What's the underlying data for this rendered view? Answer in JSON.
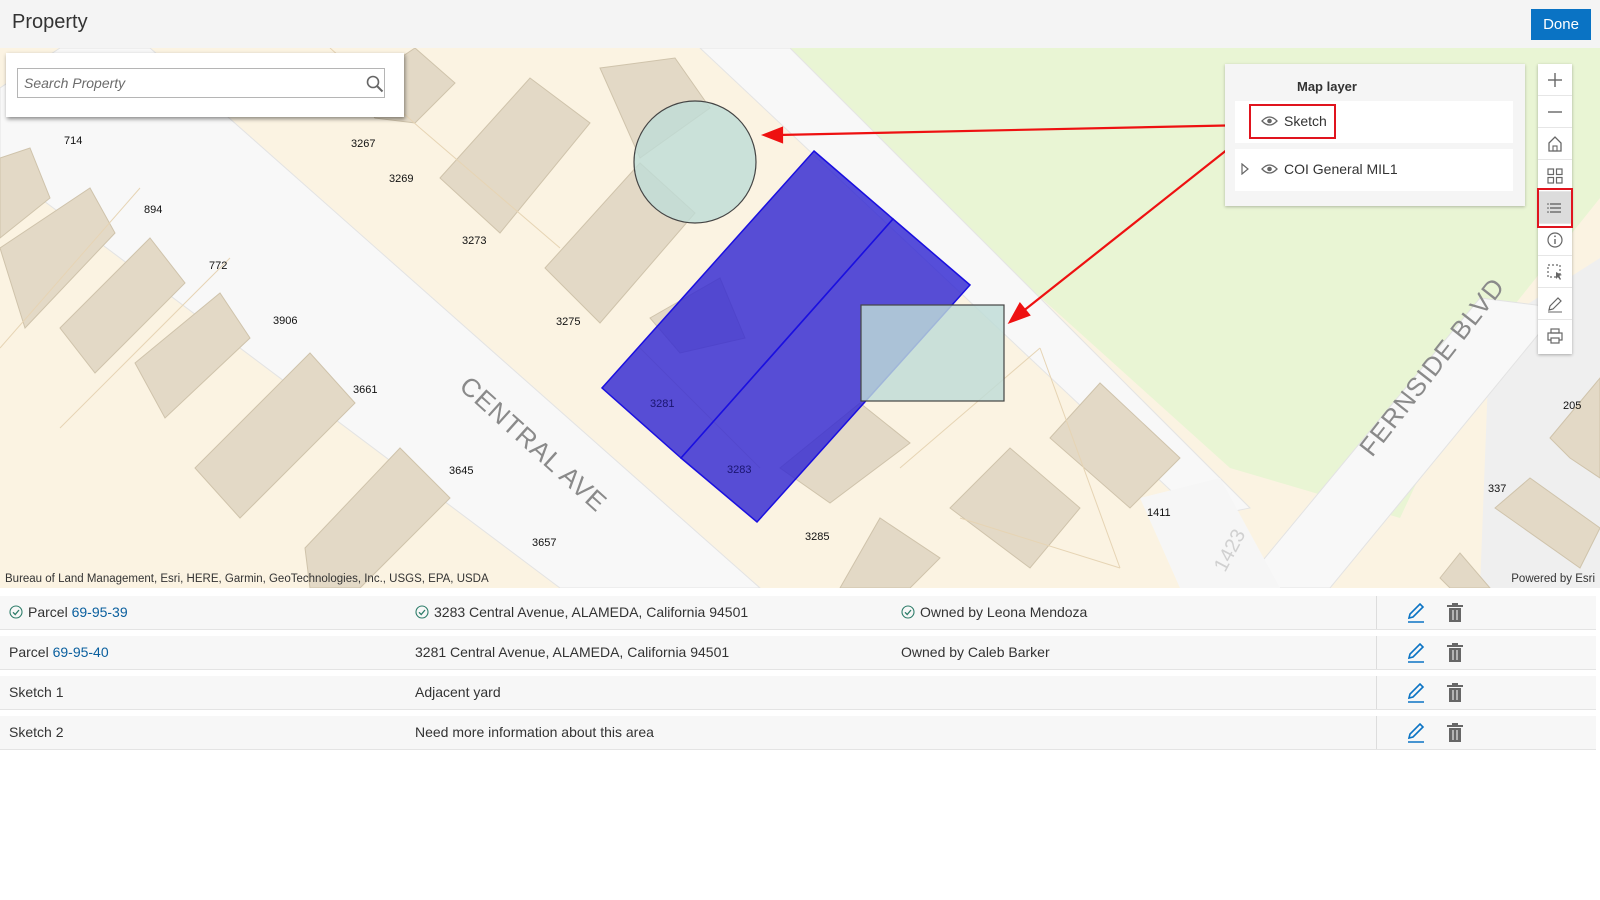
{
  "header": {
    "title": "Property",
    "done_label": "Done"
  },
  "search": {
    "placeholder": "Search Property"
  },
  "map": {
    "street_labels": [
      "CENTRAL AVE",
      "FERNSIDE BLVD"
    ],
    "parcel_labels": [
      "714",
      "3267",
      "3269",
      "894",
      "3273",
      "772",
      "3906",
      "3275",
      "3661",
      "3645",
      "3657",
      "3285",
      "1411",
      "205",
      "337",
      "3281",
      "3283",
      "1423"
    ],
    "attribution": "Bureau of Land Management, Esri, HERE, Garmin, GeoTechnologies, Inc., USGS, EPA, USDA",
    "powered_by": "Powered by Esri"
  },
  "layer_panel": {
    "title": "Map layer",
    "layers": [
      {
        "label": "Sketch",
        "icon": "eye-icon"
      },
      {
        "label": "COI General MIL1",
        "icon": "eye-icon",
        "expand_icon": "chevron-right-icon"
      }
    ]
  },
  "toolbar": {
    "tools": [
      "zoom-in-icon",
      "zoom-out-icon",
      "home-icon",
      "basemap-gallery-icon",
      "layer-list-icon",
      "info-icon",
      "select-icon",
      "sketch-pencil-icon",
      "print-icon"
    ],
    "active": "layer-list-icon"
  },
  "table": {
    "rows": [
      {
        "col1_prefix": "Parcel ",
        "col1_link": "69-95-39",
        "col2": "3283 Central Avenue, ALAMEDA, California 94501",
        "col3": "Owned by Leona Mendoza",
        "checked": true
      },
      {
        "col1_prefix": "Parcel ",
        "col1_link": "69-95-40",
        "col2": "3281 Central Avenue, ALAMEDA, California 94501",
        "col3": "Owned by Caleb Barker",
        "checked": false
      },
      {
        "col1_prefix": "Sketch 1",
        "col1_link": "",
        "col2": "Adjacent yard",
        "col3": "",
        "checked": false
      },
      {
        "col1_prefix": "Sketch 2",
        "col1_link": "",
        "col2": "Need more information about this area",
        "col3": "",
        "checked": false
      }
    ],
    "row_actions": [
      "edit-pencil-icon",
      "delete-trash-icon"
    ]
  },
  "colors": {
    "accent": "#0a73c4",
    "sketch_polygon": "#3f35d6",
    "sketch_shape": "#c9e2dd",
    "highlight": "#e0141e",
    "park": "#e9f5d4"
  }
}
